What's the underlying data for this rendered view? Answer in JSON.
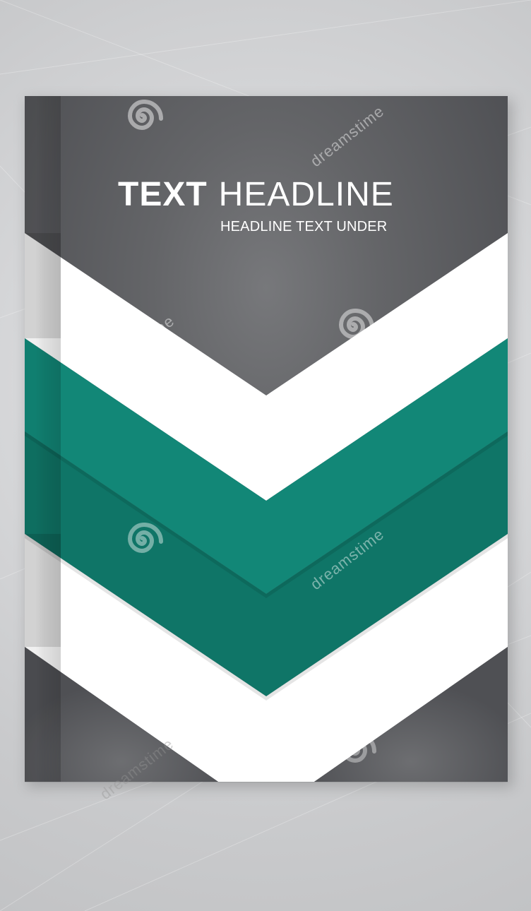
{
  "brochure": {
    "title_bold": "TEXT",
    "title_light": "HEADLINE",
    "subtitle": "HEADLINE TEXT UNDER"
  },
  "watermarks": {
    "brand": "dreamstime"
  },
  "colors": {
    "background": "#cfd0d2",
    "cover_gray": "#5b5c5f",
    "white": "#ffffff",
    "teal_light": "#128777",
    "teal_dark": "#0f7567"
  }
}
